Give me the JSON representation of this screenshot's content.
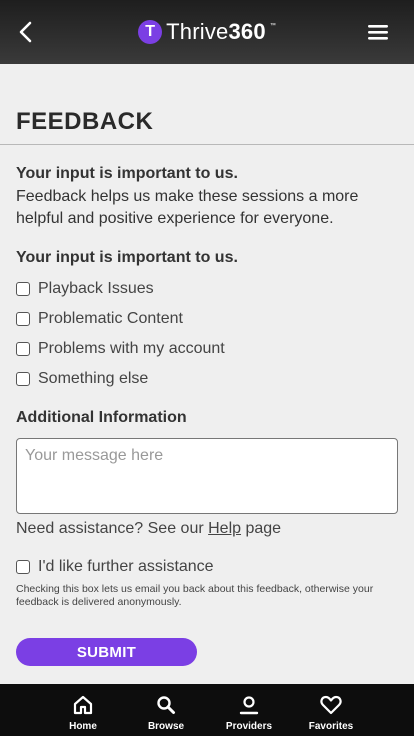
{
  "header": {
    "logo_letter": "T",
    "logo_name_regular": "Thrive",
    "logo_name_bold": "360",
    "logo_tm": "™",
    "brand_color": "#7b3fe4"
  },
  "page": {
    "title": "FEEDBACK",
    "intro_heading": "Your input is important to us.",
    "intro_body": "Feedback helps us make these sessions a more helpful and positive experience for everyone.",
    "choices_heading": "Your input is important to us.",
    "choices": [
      {
        "label": "Playback Issues",
        "checked": false
      },
      {
        "label": "Problematic Content",
        "checked": false
      },
      {
        "label": "Problems with my account",
        "checked": false
      },
      {
        "label": "Something else",
        "checked": false
      }
    ],
    "additional_heading": "Additional Information",
    "message_placeholder": "Your message here",
    "assist_prefix": "Need assistance? See our ",
    "help_link": "Help",
    "assist_suffix": " page",
    "further_assistance_label": "I'd like further assistance",
    "further_assistance_checked": false,
    "fine_print": "Checking this box lets us email you back about this feedback, otherwise your feedback is delivered anonymously.",
    "submit_label": "SUBMIT"
  },
  "nav": {
    "items": [
      {
        "label": "Home",
        "icon": "home-icon"
      },
      {
        "label": "Browse",
        "icon": "search-icon"
      },
      {
        "label": "Providers",
        "icon": "person-icon"
      },
      {
        "label": "Favorites",
        "icon": "heart-icon"
      }
    ]
  }
}
